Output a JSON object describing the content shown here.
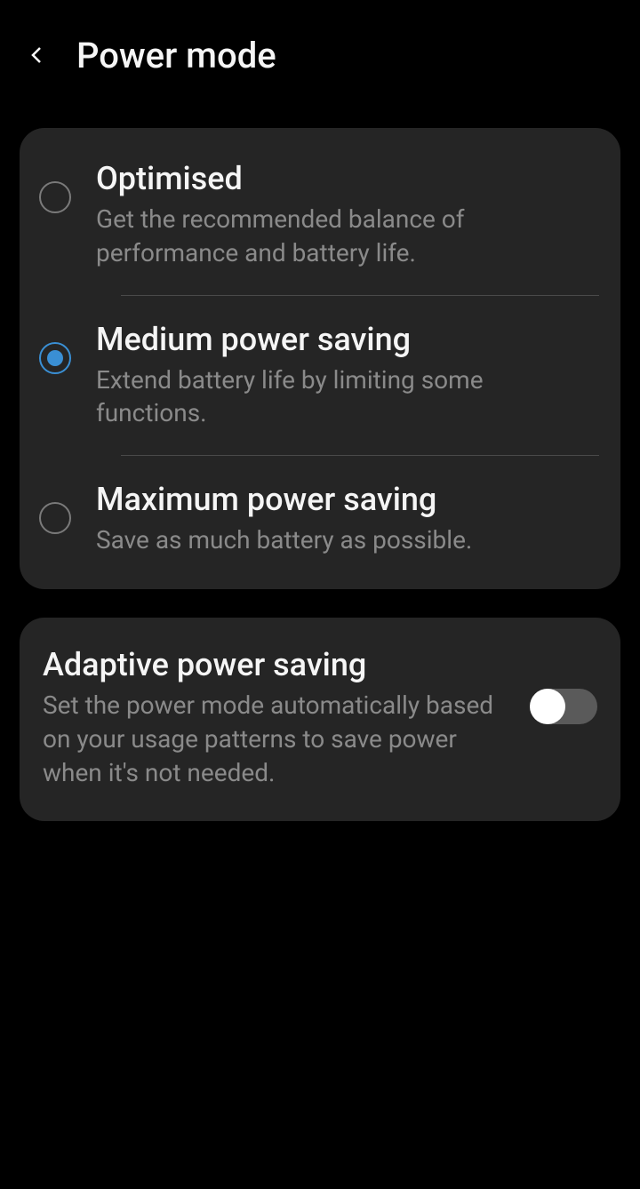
{
  "header": {
    "title": "Power mode"
  },
  "options": [
    {
      "title": "Optimised",
      "description": "Get the recommended balance of performance and battery life.",
      "selected": false
    },
    {
      "title": "Medium power saving",
      "description": "Extend battery life by limiting some functions.",
      "selected": true
    },
    {
      "title": "Maximum power saving",
      "description": "Save as much battery as possible.",
      "selected": false
    }
  ],
  "adaptive": {
    "title": "Adaptive power saving",
    "description": "Set the power mode automatically based on your usage patterns to save power when it's not needed.",
    "enabled": false
  }
}
